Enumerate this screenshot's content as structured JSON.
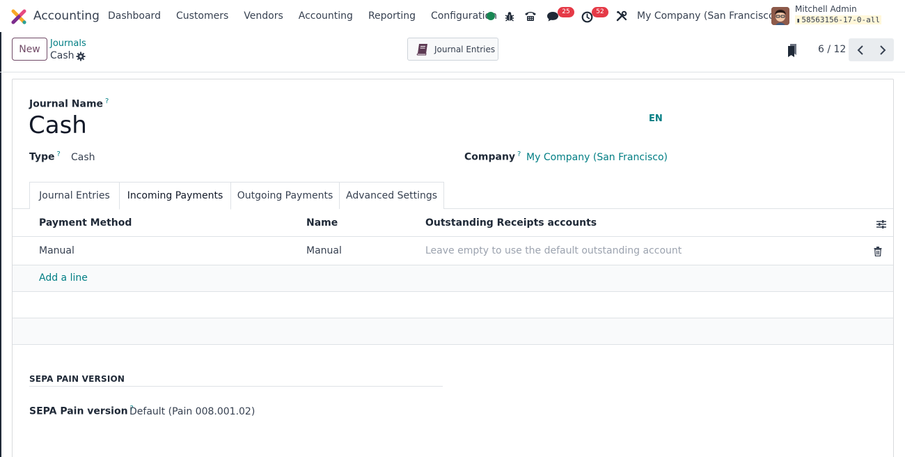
{
  "navbar": {
    "app_name": "Accounting",
    "menu": [
      "Dashboard",
      "Customers",
      "Vendors",
      "Accounting",
      "Reporting",
      "Configuration"
    ],
    "chat_count": "25",
    "activity_count": "52",
    "company": "My Company (San Francisco)",
    "user_name": "Mitchell Admin",
    "database": "58563156-17-0-all",
    "icons": [
      "status-dot-icon",
      "bug-icon",
      "phone-icon",
      "chat-icon",
      "clock-icon",
      "tools-icon"
    ],
    "status_color": "#198754"
  },
  "control": {
    "new_label": "New",
    "breadcrumb_parent": "Journals",
    "breadcrumb_current": "Cash",
    "smart_button": "Journal Entries",
    "pager": "6 / 12"
  },
  "form": {
    "journal_name_label": "Journal Name",
    "help_mark": "?",
    "journal_name": "Cash",
    "lang": "EN",
    "type_label": "Type",
    "type_value": "Cash",
    "company_label": "Company",
    "company_value": "My Company (San Francisco)",
    "tabs": [
      "Journal Entries",
      "Incoming Payments",
      "Outgoing Payments",
      "Advanced Settings"
    ],
    "active_tab": "Incoming Payments",
    "table": {
      "headers": [
        "Payment Method",
        "Name",
        "Outstanding Receipts accounts"
      ],
      "rows": [
        {
          "payment_method": "Manual",
          "name": "Manual",
          "account_placeholder": "Leave empty to use the default outstanding account"
        }
      ],
      "add_line": "Add a line"
    },
    "sepa": {
      "section_title": "SEPA PAIN VERSION",
      "label": "SEPA Pain version",
      "value": "Default (Pain 008.001.02)"
    }
  },
  "colors": {
    "brand": "#714b67",
    "link": "#017e84",
    "badge": "#e53946"
  }
}
